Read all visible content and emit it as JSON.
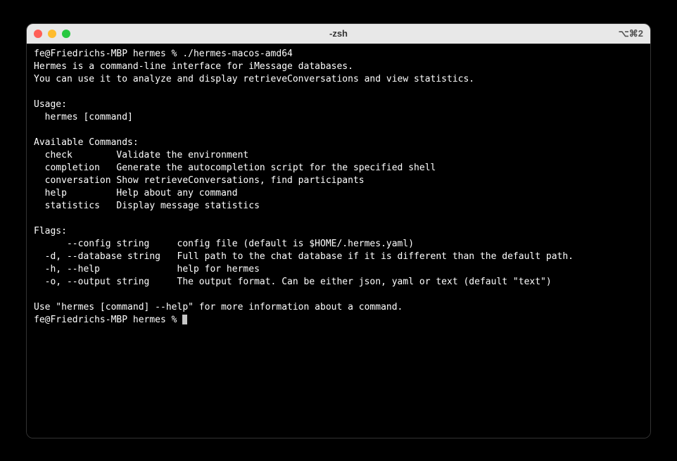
{
  "titlebar": {
    "title": "-zsh",
    "right_indicator": "⌥⌘2"
  },
  "terminal": {
    "prompt1_prefix": "fe@Friedrichs-MBP hermes % ",
    "prompt1_command": "./hermes-macos-amd64",
    "desc_line1": "Hermes is a command-line interface for iMessage databases.",
    "desc_line2": "You can use it to analyze and display retrieveConversations and view statistics.",
    "usage_header": "Usage:",
    "usage_line": "  hermes [command]",
    "avail_header": "Available Commands:",
    "cmd_check": "  check        Validate the environment",
    "cmd_completion": "  completion   Generate the autocompletion script for the specified shell",
    "cmd_conversation": "  conversation Show retrieveConversations, find participants",
    "cmd_help": "  help         Help about any command",
    "cmd_statistics": "  statistics   Display message statistics",
    "flags_header": "Flags:",
    "flag_config": "      --config string     config file (default is $HOME/.hermes.yaml)",
    "flag_database": "  -d, --database string   Full path to the chat database if it is different than the default path.",
    "flag_help": "  -h, --help              help for hermes",
    "flag_output": "  -o, --output string     The output format. Can be either json, yaml or text (default \"text\")",
    "footer": "Use \"hermes [command] --help\" for more information about a command.",
    "prompt2_prefix": "fe@Friedrichs-MBP hermes % "
  }
}
